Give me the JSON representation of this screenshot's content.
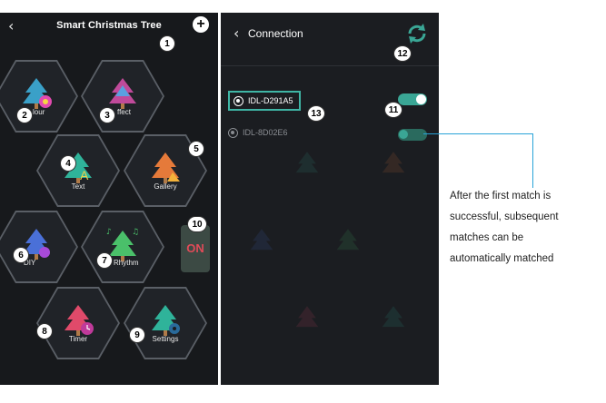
{
  "left_screen": {
    "title": "Smart Christmas Tree",
    "back_icon": "chevron-left-icon",
    "add_icon": "plus-icon",
    "tiles": [
      {
        "label": "Colour",
        "visible_label": "lour",
        "badge": "2",
        "icon": "christmas-tree-color-icon"
      },
      {
        "label": "Effect",
        "visible_label": "ffect",
        "badge": "3",
        "icon": "christmas-tree-effect-icon"
      },
      {
        "label": "Text",
        "badge": "4",
        "icon": "christmas-tree-text-icon"
      },
      {
        "label": "Gallery",
        "badge": "5",
        "icon": "christmas-tree-gallery-icon"
      },
      {
        "label": "DIY",
        "badge": "6",
        "icon": "christmas-tree-diy-icon"
      },
      {
        "label": "Rhythm",
        "visible_label": "Rhythm",
        "badge": "7",
        "icon": "christmas-tree-music-icon"
      },
      {
        "label": "Timer",
        "badge": "8",
        "icon": "christmas-tree-timer-icon"
      },
      {
        "label": "Settings",
        "badge": "9",
        "icon": "christmas-tree-settings-icon"
      }
    ],
    "power_button": {
      "label": "ON",
      "badge": "10"
    },
    "add_badge": "1"
  },
  "right_screen": {
    "title": "Connection",
    "refresh_badge": "12",
    "devices": [
      {
        "name": "IDL-D291A5",
        "badge": "13",
        "toggle_on": true,
        "toggle_badge": "11"
      },
      {
        "name": "IDL-8D02E6",
        "toggle_on": false
      }
    ]
  },
  "note": {
    "text_lines": [
      "After the first match is",
      "successful, subsequent",
      "matches can be",
      "automatically matched"
    ]
  },
  "colors": {
    "accent": "#3aa695",
    "callout": "#29a3d8",
    "on_text": "#e04b58"
  }
}
